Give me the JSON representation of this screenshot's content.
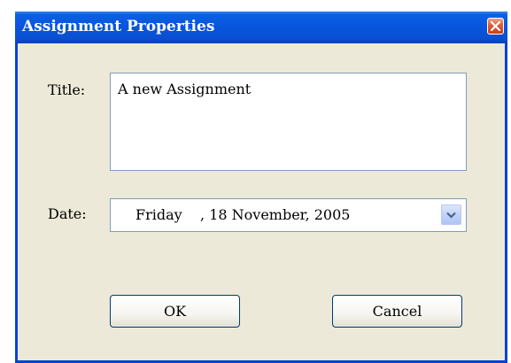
{
  "window": {
    "title": "Assignment Properties",
    "titlebar_color": "#0855dd",
    "background_color": "#ece9d8"
  },
  "icons": {
    "close": "close-icon",
    "dropdown": "chevron-down-icon"
  },
  "form": {
    "title_label": "Title:",
    "title_value": "A new Assignment",
    "date_label": "Date:",
    "date_value": "Friday    , 18 November, 2005"
  },
  "buttons": {
    "ok_label": "OK",
    "cancel_label": "Cancel"
  }
}
